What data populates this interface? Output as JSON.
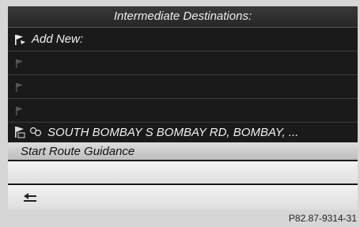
{
  "header": {
    "title": "Intermediate Destinations:"
  },
  "rows": [
    {
      "label": "Add New:",
      "icon": "flag-add-icon"
    },
    {
      "label": "",
      "icon": "flag-icon"
    },
    {
      "label": "",
      "icon": "flag-icon"
    },
    {
      "label": "",
      "icon": "flag-icon"
    },
    {
      "label": "SOUTH BOMBAY S BOMBAY RD, BOMBAY, ...",
      "icon": "destination-flag-icon"
    }
  ],
  "actions": {
    "start_guidance": "Start Route Guidance"
  },
  "footer": {
    "back_icon": "back-arrow-icon"
  },
  "caption": "P82.87-9314-31",
  "colors": {
    "screen_bg": "#1a1a1a",
    "highlight_bar": "#d0d0d0",
    "page_bg": "#d6d6d6"
  }
}
